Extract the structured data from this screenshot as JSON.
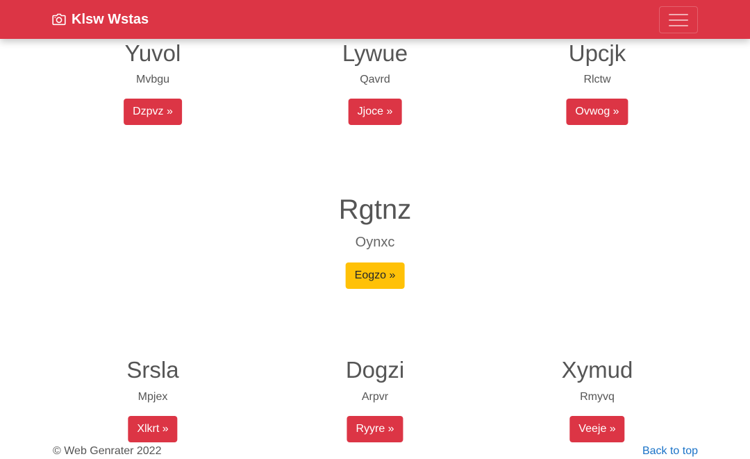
{
  "navbar": {
    "brand": "Klsw Wstas",
    "brand_icon": "camera-icon",
    "toggler_icon": "hamburger-menu-icon",
    "bg_color": "#dc3545"
  },
  "top_row": [
    {
      "title": "Yuvol",
      "subtitle": "Mvbgu",
      "button": "Dzpvz »"
    },
    {
      "title": "Lywue",
      "subtitle": "Qavrd",
      "button": "Jjoce »"
    },
    {
      "title": "Upcjk",
      "subtitle": "Rlctw",
      "button": "Ovwog »"
    }
  ],
  "featured": {
    "title": "Rgtnz",
    "subtitle": "Oynxc",
    "button": "Eogzo »",
    "button_color": "#ffc107"
  },
  "bottom_row": [
    {
      "title": "Srsla",
      "subtitle": "Mpjex",
      "button": "Xlkrt »"
    },
    {
      "title": "Dogzi",
      "subtitle": "Arpvr",
      "button": "Ryyre »"
    },
    {
      "title": "Xymud",
      "subtitle": "Rmyvq",
      "button": "Veeje »"
    }
  ],
  "footer": {
    "copyright": "© Web Genrater 2022",
    "back_to_top": "Back to top",
    "link_color": "#1a73c8"
  }
}
